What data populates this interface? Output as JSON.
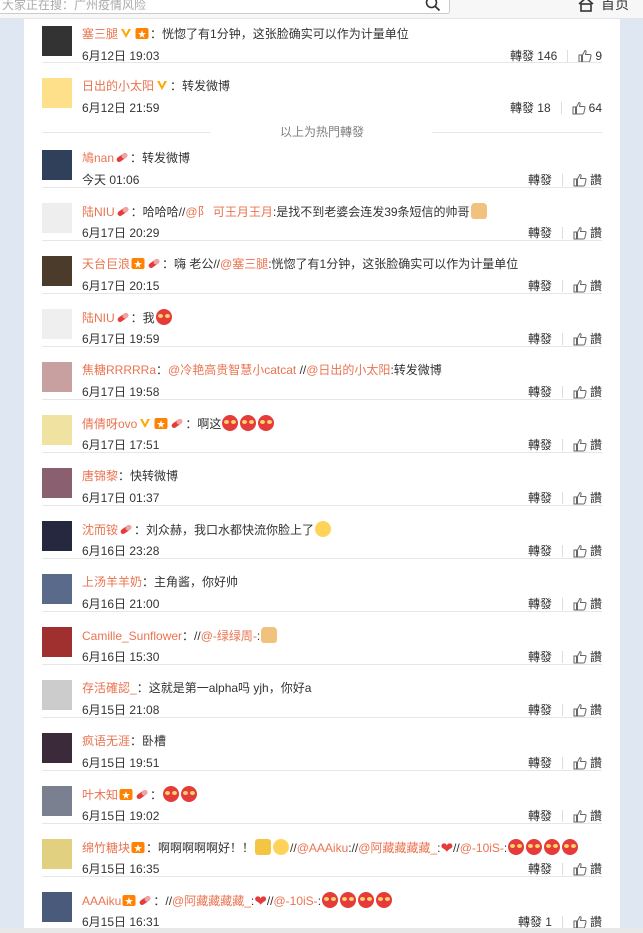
{
  "header": {
    "search_value": "大家正在搜：广州疫情风险",
    "home_label": "首页"
  },
  "hot_separator": "以上为热門轉發",
  "actions_label": "轉發",
  "comments": [
    {
      "name": "塞三腿",
      "badges": [
        "v",
        "star"
      ],
      "segments": [
        {
          "t": "text",
          "v": "：恍惚了有1分钟，这张脸确实可以作为计量单位"
        }
      ],
      "time": "6月12日 19:03",
      "repost": "轉發 146",
      "like": "9"
    },
    {
      "name": "日出的小太阳",
      "badges": [
        "v"
      ],
      "segments": [
        {
          "t": "text",
          "v": "：转发微博"
        }
      ],
      "time": "6月12日 21:59",
      "repost": "轉發 18",
      "like": "64"
    },
    {
      "name": "鳩nan",
      "badges": [
        "pill"
      ],
      "segments": [
        {
          "t": "text",
          "v": "：转发微博"
        }
      ],
      "time": "今天 01:06",
      "repost": "轉發",
      "like": "讚"
    },
    {
      "name": "陆NIU",
      "badges": [
        "pill"
      ],
      "segments": [
        {
          "t": "text",
          "v": "：哈哈哈//"
        },
        {
          "t": "link",
          "v": "@阝 可王月王月"
        },
        {
          "t": "text",
          "v": ":是找不到老婆会连发39条短信的帅哥"
        },
        {
          "t": "emoji",
          "v": "thumb"
        }
      ],
      "time": "6月17日 20:29",
      "repost": "轉發",
      "like": "讚"
    },
    {
      "name": "天台巨浪",
      "badges": [
        "star",
        "pill"
      ],
      "segments": [
        {
          "t": "text",
          "v": "：嗨 老公//"
        },
        {
          "t": "link",
          "v": "@塞三腿"
        },
        {
          "t": "text",
          "v": ":恍惚了有1分钟，这张脸确实可以作为计量单位"
        }
      ],
      "time": "6月17日 20:15",
      "repost": "轉發",
      "like": "讚"
    },
    {
      "name": "陆NIU",
      "badges": [
        "pill"
      ],
      "segments": [
        {
          "t": "text",
          "v": "：我"
        },
        {
          "t": "emoji",
          "v": "heart"
        }
      ],
      "time": "6月17日 19:59",
      "repost": "轉發",
      "like": "讚"
    },
    {
      "name": "焦糖RRRRRa",
      "badges": [],
      "segments": [
        {
          "t": "text",
          "v": "："
        },
        {
          "t": "link",
          "v": "@冷艳高贵智慧小catcat"
        },
        {
          "t": "text",
          "v": " //"
        },
        {
          "t": "link",
          "v": "@日出的小太阳"
        },
        {
          "t": "text",
          "v": ":转发微博"
        }
      ],
      "time": "6月17日 19:58",
      "repost": "轉發",
      "like": "讚"
    },
    {
      "name": "倩倩呀ovo",
      "badges": [
        "v",
        "star",
        "pill"
      ],
      "segments": [
        {
          "t": "text",
          "v": "：啊这"
        },
        {
          "t": "emoji",
          "v": "heart"
        },
        {
          "t": "emoji",
          "v": "heart"
        },
        {
          "t": "emoji",
          "v": "heart"
        }
      ],
      "time": "6月17日 17:51",
      "repost": "轉發",
      "like": "讚"
    },
    {
      "name": "唐锦黎",
      "badges": [],
      "segments": [
        {
          "t": "text",
          "v": "：快转微博"
        }
      ],
      "time": "6月17日 01:37",
      "repost": "轉發",
      "like": "讚"
    },
    {
      "name": "沈而铵",
      "badges": [
        "pill"
      ],
      "segments": [
        {
          "t": "text",
          "v": "：刘众赫，我口水都快流你脸上了"
        },
        {
          "t": "emoji",
          "v": "cry"
        }
      ],
      "time": "6月16日 23:28",
      "repost": "轉發",
      "like": "讚"
    },
    {
      "name": "上汤羊羊奶",
      "badges": [],
      "segments": [
        {
          "t": "text",
          "v": "：主角酱，你好帅"
        }
      ],
      "time": "6月16日 21:00",
      "repost": "轉發",
      "like": "讚"
    },
    {
      "name": "Camille_Sunflower",
      "badges": [],
      "segments": [
        {
          "t": "text",
          "v": "：//"
        },
        {
          "t": "link",
          "v": "@-绿绿周-"
        },
        {
          "t": "text",
          "v": ":"
        },
        {
          "t": "emoji",
          "v": "thumb"
        }
      ],
      "time": "6月16日 15:30",
      "repost": "轉發",
      "like": "讚"
    },
    {
      "name": "存活確認_",
      "badges": [],
      "segments": [
        {
          "t": "text",
          "v": "：这就是第一alpha吗 yjh，你好a"
        }
      ],
      "time": "6月15日 21:08",
      "repost": "轉發",
      "like": "讚"
    },
    {
      "name": "疯语无涯",
      "badges": [],
      "segments": [
        {
          "t": "text",
          "v": "：卧槽"
        }
      ],
      "time": "6月15日 19:51",
      "repost": "轉發",
      "like": "讚"
    },
    {
      "name": "叶木知",
      "badges": [
        "star",
        "pill"
      ],
      "segments": [
        {
          "t": "text",
          "v": "："
        },
        {
          "t": "emoji",
          "v": "heart"
        },
        {
          "t": "emoji",
          "v": "heart"
        }
      ],
      "time": "6月15日 19:02",
      "repost": "轉發",
      "like": "讚"
    },
    {
      "name": "绵竹糖块",
      "badges": [
        "star"
      ],
      "segments": [
        {
          "t": "text",
          "v": "：啊啊啊啊啊好！！"
        },
        {
          "t": "emoji",
          "v": "gift"
        },
        {
          "t": "emoji",
          "v": "cry"
        },
        {
          "t": "text",
          "v": "//"
        },
        {
          "t": "link",
          "v": "@AAAiku"
        },
        {
          "t": "text",
          "v": "://"
        },
        {
          "t": "link",
          "v": "@阿藏藏藏藏_"
        },
        {
          "t": "text",
          "v": ":"
        },
        {
          "t": "emoji",
          "v": "redheart"
        },
        {
          "t": "text",
          "v": "//"
        },
        {
          "t": "link",
          "v": "@-10iS-"
        },
        {
          "t": "text",
          "v": ":"
        },
        {
          "t": "emoji",
          "v": "heart"
        },
        {
          "t": "emoji",
          "v": "heart"
        },
        {
          "t": "emoji",
          "v": "heart"
        },
        {
          "t": "emoji",
          "v": "heart"
        }
      ],
      "time": "6月15日 16:35",
      "repost": "轉發",
      "like": "讚"
    },
    {
      "name": "AAAiku",
      "badges": [
        "star",
        "pill"
      ],
      "segments": [
        {
          "t": "text",
          "v": "：//"
        },
        {
          "t": "link",
          "v": "@阿藏藏藏藏_"
        },
        {
          "t": "text",
          "v": ":"
        },
        {
          "t": "emoji",
          "v": "redheart"
        },
        {
          "t": "text",
          "v": "//"
        },
        {
          "t": "link",
          "v": "@-10iS-"
        },
        {
          "t": "text",
          "v": ":"
        },
        {
          "t": "emoji",
          "v": "heart"
        },
        {
          "t": "emoji",
          "v": "heart"
        },
        {
          "t": "emoji",
          "v": "heart"
        },
        {
          "t": "emoji",
          "v": "heart"
        }
      ],
      "time": "6月15日 16:31",
      "repost": "轉發 1",
      "like": "讚"
    }
  ],
  "colors": {
    "link": "#eb7350",
    "bg": "#dfe8f2",
    "panel": "#ffffff",
    "v_badge": "#ffa800",
    "star_badge": "#ff8200"
  },
  "avatar_colors": [
    "#333",
    "#ffe08a",
    "#30405a",
    "#eeeeee",
    "#4a3b2b",
    "#efefef",
    "#c9a0a0",
    "#f0e2a0",
    "#8a6070",
    "#262840",
    "#5a6a8a",
    "#a03030",
    "#cccccc",
    "#3a2a3a",
    "#7a8090",
    "#e0d080",
    "#4a5a7a"
  ]
}
